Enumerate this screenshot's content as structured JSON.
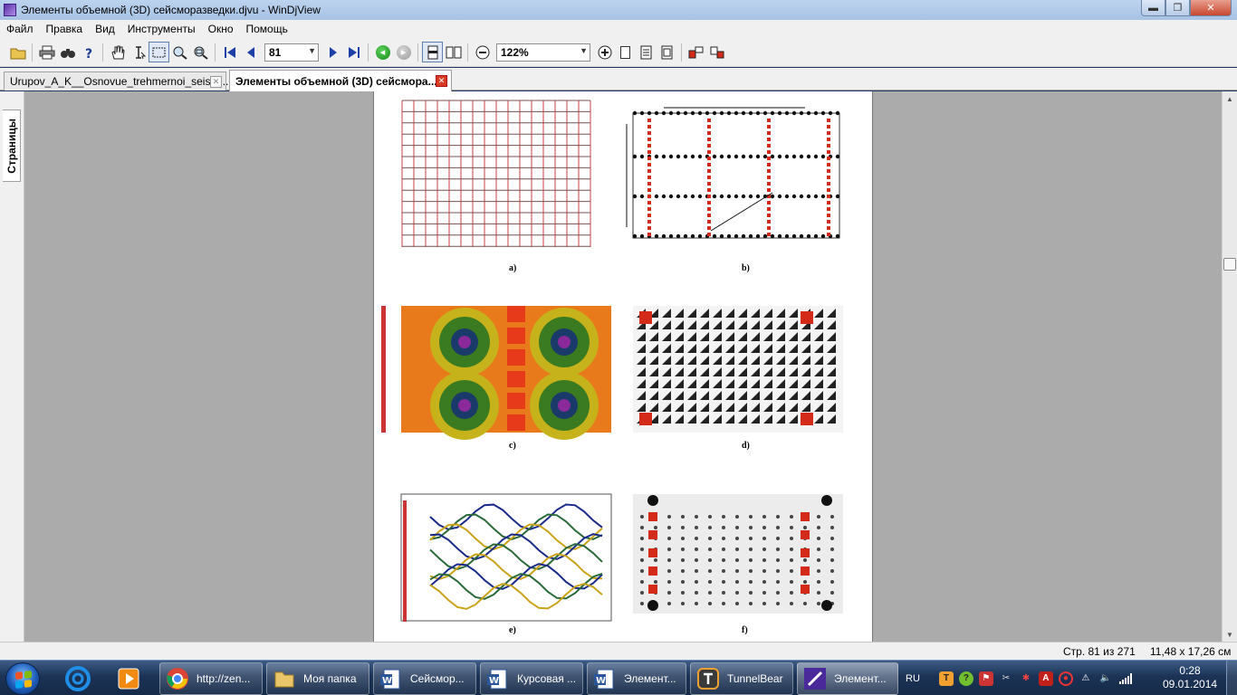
{
  "window": {
    "title": "Элементы объемной (3D) сейсморазведки.djvu - WinDjView",
    "minimize_glyph": "▬",
    "maximize_glyph": "❐",
    "close_glyph": "✕"
  },
  "menu": [
    "Файл",
    "Правка",
    "Вид",
    "Инструменты",
    "Окно",
    "Помощь"
  ],
  "toolbar": {
    "page_number": "81",
    "zoom": "122%"
  },
  "tabs": [
    {
      "label": "Urupov_A_K__Osnovue_trehmernoi_seism...",
      "active": false
    },
    {
      "label": "Элементы объемной (3D) сейсмора...",
      "active": true
    }
  ],
  "sidebar": {
    "pages_tab": "Страницы"
  },
  "document": {
    "figure_labels": [
      "a)",
      "b)",
      "c)",
      "d)",
      "e)",
      "f)"
    ]
  },
  "statusbar": {
    "page_info": "Стр. 81 из 271",
    "page_size": "11,48 x 17,26 см"
  },
  "taskbar": {
    "items": [
      {
        "label": "http://zen...",
        "icon": "chrome-icon"
      },
      {
        "label": "Моя папка",
        "icon": "folder-icon"
      },
      {
        "label": "Сейсмор...",
        "icon": "word-icon"
      },
      {
        "label": "Курсовая ...",
        "icon": "word-icon"
      },
      {
        "label": "Элемент...",
        "icon": "word-icon"
      },
      {
        "label": "TunnelBear",
        "icon": "tunnelbear-icon"
      },
      {
        "label": "Элемент...",
        "icon": "windjview-icon"
      }
    ],
    "language": "RU",
    "time": "0:28",
    "date": "09.01.2014"
  },
  "colors": {
    "accent_red": "#d42a1a",
    "taskbar": "#1c3356",
    "viewer_bg": "#ababab"
  }
}
